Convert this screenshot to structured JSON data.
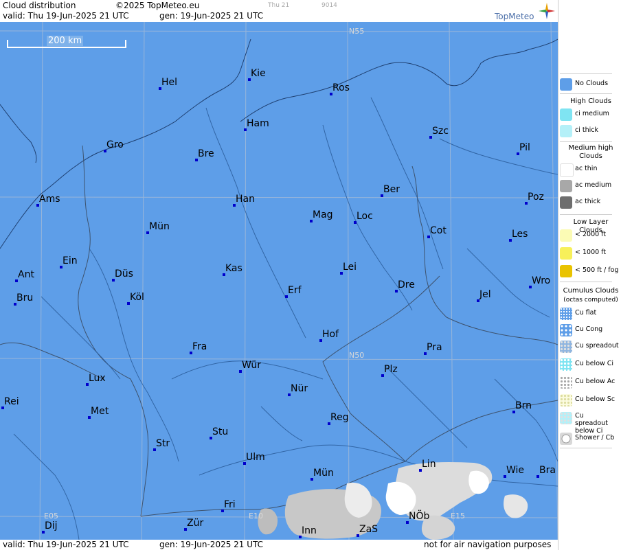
{
  "header": {
    "title": "Cloud distribution",
    "copyright": "©2025 TopMeteo.eu",
    "valid": "valid:  Thu  19-Jun-2025  21 UTC",
    "gen": "gen: 19-Jun-2025 21 UTC",
    "faint_day": "Thu 21",
    "faint_code": "9014",
    "brand": "TopMeteo"
  },
  "scale": {
    "label": "200 km"
  },
  "grid_labels": {
    "n55": "N55",
    "n50": "N50",
    "e05": "E05",
    "e10": "E10",
    "e15": "E15"
  },
  "cities": [
    {
      "name": "Kie"
    },
    {
      "name": "Hel"
    },
    {
      "name": "Ros"
    },
    {
      "name": "Ham"
    },
    {
      "name": "Szc"
    },
    {
      "name": "Gro"
    },
    {
      "name": "Bre"
    },
    {
      "name": "Pil"
    },
    {
      "name": "Ber"
    },
    {
      "name": "Ams"
    },
    {
      "name": "Han"
    },
    {
      "name": "Poz"
    },
    {
      "name": "Mag"
    },
    {
      "name": "Loc"
    },
    {
      "name": "Mün"
    },
    {
      "name": "Cot"
    },
    {
      "name": "Les"
    },
    {
      "name": "Ein"
    },
    {
      "name": "Kas"
    },
    {
      "name": "Lei"
    },
    {
      "name": "Ant"
    },
    {
      "name": "Düs"
    },
    {
      "name": "Wro"
    },
    {
      "name": "Erf"
    },
    {
      "name": "Dre"
    },
    {
      "name": "Bru"
    },
    {
      "name": "Köl"
    },
    {
      "name": "Jel"
    },
    {
      "name": "Hof"
    },
    {
      "name": "Fra"
    },
    {
      "name": "Pra"
    },
    {
      "name": "Wür"
    },
    {
      "name": "Plz"
    },
    {
      "name": "Lux"
    },
    {
      "name": "Nür"
    },
    {
      "name": "Rei"
    },
    {
      "name": "Met"
    },
    {
      "name": "Reg"
    },
    {
      "name": "Brn"
    },
    {
      "name": "Stu"
    },
    {
      "name": "Str"
    },
    {
      "name": "Ulm"
    },
    {
      "name": "Lin"
    },
    {
      "name": "Mün"
    },
    {
      "name": "Wie"
    },
    {
      "name": "Bra"
    },
    {
      "name": "Fri"
    },
    {
      "name": "NÖb"
    },
    {
      "name": "Dij"
    },
    {
      "name": "Zür"
    },
    {
      "name": "Inn"
    },
    {
      "name": "ZaS"
    }
  ],
  "footer": {
    "valid": "valid:  Thu  19-Jun-2025  21 UTC",
    "gen": "gen: 19-Jun-2025 21 UTC",
    "disclaimer": "not for air navigation purposes"
  },
  "legend": {
    "no_clouds": "No Clouds",
    "high_head": "High Clouds",
    "ci_medium": "ci medium",
    "ci_thick": "ci thick",
    "medium_head": "Medium high Clouds",
    "ac_thin": "ac thin",
    "ac_medium": "ac medium",
    "ac_thick": "ac thick",
    "low_head": "Low Layer Clouds",
    "low1": "< 2000 ft",
    "low2": "< 1000 ft",
    "low3": "< 500 ft / fog",
    "cu_head": "Cumulus Clouds",
    "cu_sub": "(octas computed)",
    "cu_flat": "Cu flat",
    "cu_cong": "Cu Cong",
    "cu_spread": "Cu spreadout",
    "cu_below_ci": "Cu below Ci",
    "cu_below_ac": "Cu below Ac",
    "cu_below_sc": "Cu below Sc",
    "cu_spread_ci": "Cu spreadout below Ci",
    "shower": "Shower / Cb"
  },
  "colors": {
    "map_bg": "#5e9ee8",
    "no_clouds": "#5e9ee8",
    "ci_medium": "#7fe4f2",
    "ci_thick": "#b4f0f8",
    "ac_thin": "#ffffff",
    "ac_medium": "#a8a8a8",
    "ac_thick": "#6e6e6e",
    "low1": "#fbfbb5",
    "low2": "#f7f05a",
    "low3": "#e9c300",
    "city_marker": "#0000cc"
  }
}
